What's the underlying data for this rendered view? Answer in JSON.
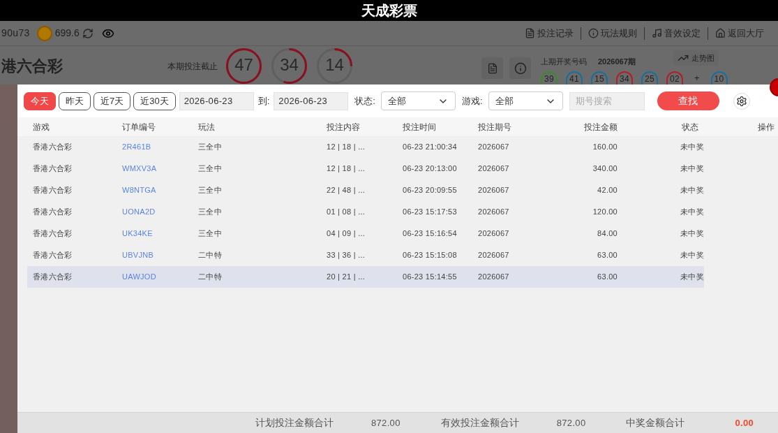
{
  "app_title": "天成彩票",
  "user": {
    "name": "90u73",
    "balance": "699.6"
  },
  "top_menu": [
    "投注记录",
    "玩法规则",
    "音效设定",
    "返回大厅"
  ],
  "lottery": {
    "name": "港六合彩",
    "deadline_label": "本期投注截止",
    "countdown": [
      {
        "value": "47",
        "level": 1
      },
      {
        "value": "34",
        "level": 0.55
      },
      {
        "value": "14",
        "level": 0.25
      }
    ],
    "last_draw_label": "上期开奖号码",
    "last_draw_issue": "2026067期",
    "trend_button": "走势图",
    "balls": [
      {
        "value": "39",
        "color": "#3a8a2a"
      },
      {
        "value": "41",
        "color": "#1a6e9a"
      },
      {
        "value": "15",
        "color": "#1a6e9a"
      },
      {
        "value": "34",
        "color": "#b0202a"
      },
      {
        "value": "25",
        "color": "#1a6e9a"
      },
      {
        "value": "02",
        "color": "#b0202a"
      }
    ],
    "plus": "+",
    "special_ball": {
      "value": "10",
      "color": "#1a6e9a"
    }
  },
  "filters": {
    "quick_ranges": [
      {
        "label": "今天",
        "selected": true
      },
      {
        "label": "昨天",
        "selected": false
      },
      {
        "label": "近7天",
        "selected": false
      },
      {
        "label": "近30天",
        "selected": false
      }
    ],
    "date_from": "2026-06-23",
    "to_label": "到:",
    "date_to": "2026-06-23",
    "status_label": "状态:",
    "status_value": "全部",
    "game_label": "游戏:",
    "game_value": "全部",
    "issue_search": {
      "placeholder": "期号搜索"
    },
    "search_button": "查找"
  },
  "table": {
    "columns": [
      "游戏",
      "订单编号",
      "玩法",
      "投注内容",
      "投注时间",
      "投注期号",
      "投注金额",
      "状态",
      "操作"
    ],
    "rows": [
      {
        "game": "香港六合彩",
        "order": "2R461B",
        "play": "三全中",
        "content": "12 | 18 | ...",
        "time": "06-23 21:00:34",
        "issue": "2026067",
        "amount": "160.00",
        "status": "未中奖",
        "selected": false
      },
      {
        "game": "香港六合彩",
        "order": "WMXV3A",
        "play": "三全中",
        "content": "12 | 18 | ...",
        "time": "06-23 20:13:00",
        "issue": "2026067",
        "amount": "340.00",
        "status": "未中奖",
        "selected": false
      },
      {
        "game": "香港六合彩",
        "order": "W8NTGA",
        "play": "三全中",
        "content": "22 | 48 | ...",
        "time": "06-23 20:09:55",
        "issue": "2026067",
        "amount": "42.00",
        "status": "未中奖",
        "selected": false
      },
      {
        "game": "香港六合彩",
        "order": "UONA2D",
        "play": "三全中",
        "content": "01 | 08 | ...",
        "time": "06-23 15:17:53",
        "issue": "2026067",
        "amount": "120.00",
        "status": "未中奖",
        "selected": false
      },
      {
        "game": "香港六合彩",
        "order": "UK34KE",
        "play": "三全中",
        "content": "04 | 09 | ...",
        "time": "06-23 15:16:54",
        "issue": "2026067",
        "amount": "84.00",
        "status": "未中奖",
        "selected": false
      },
      {
        "game": "香港六合彩",
        "order": "UBVJNB",
        "play": "二中特",
        "content": "33 | 36 | ...",
        "time": "06-23 15:15:08",
        "issue": "2026067",
        "amount": "63.00",
        "status": "未中奖",
        "selected": false
      },
      {
        "game": "香港六合彩",
        "order": "UAWJOD",
        "play": "二中特",
        "content": "20 | 21 | ...",
        "time": "06-23 15:14:55",
        "issue": "2026067",
        "amount": "63.00",
        "status": "未中奖",
        "selected": true
      }
    ]
  },
  "totals": [
    {
      "label": "计划投注金额合计",
      "value": "872.00",
      "highlight": false
    },
    {
      "label": "有效投注金额合计",
      "value": "872.00",
      "highlight": false
    },
    {
      "label": "中奖金额合计",
      "value": "0.00",
      "highlight": true
    }
  ]
}
